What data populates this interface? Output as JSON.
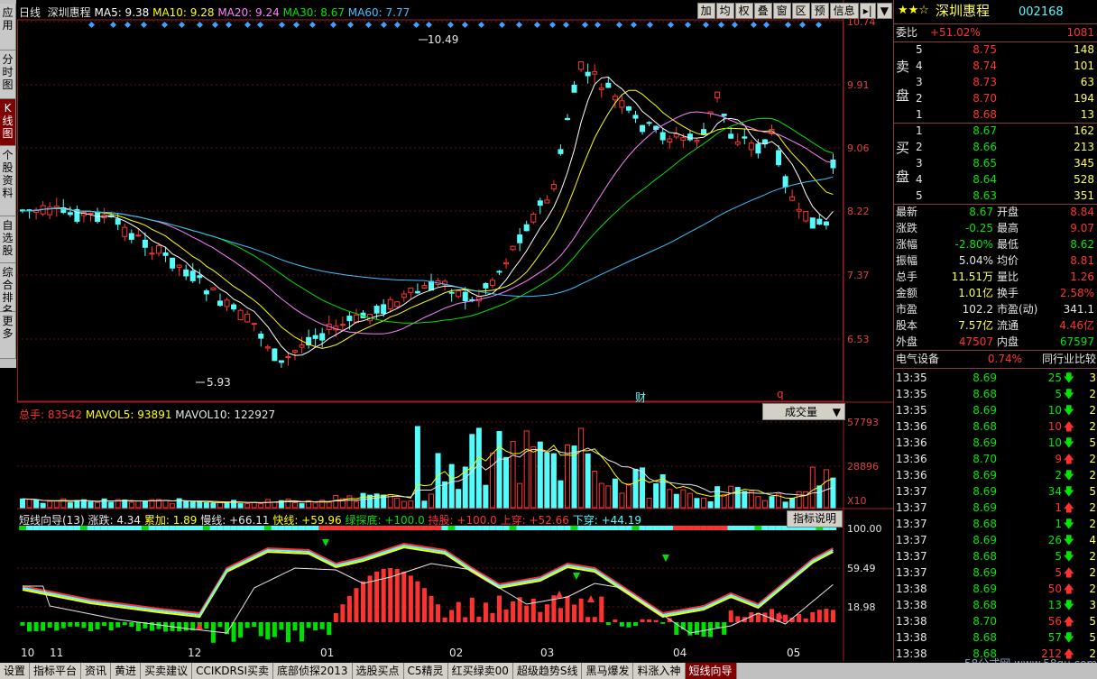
{
  "left_tabs": [
    {
      "label": "应用"
    },
    {
      "label": "分时图"
    },
    {
      "label": "K线图",
      "active": true
    },
    {
      "label": "个股资料"
    },
    {
      "label": "自选股"
    },
    {
      "label": "综合排名"
    },
    {
      "label": "更多"
    }
  ],
  "toolbar": [
    "加",
    "均",
    "权",
    "叠",
    "窗",
    "区",
    "预",
    "信息"
  ],
  "main_legend": {
    "period": "日线",
    "name": "深圳惠程",
    "ma": [
      {
        "label": "MA5: 9.38",
        "color": "#ffffff"
      },
      {
        "label": "MA10: 9.28",
        "color": "#ffff00"
      },
      {
        "label": "MA20: 9.24",
        "color": "#ff80ff"
      },
      {
        "label": "MA30: 8.67",
        "color": "#00e000"
      },
      {
        "label": "MA60: 7.77",
        "color": "#40c0ff"
      }
    ]
  },
  "price_axis": [
    "10.74",
    "9.91",
    "9.06",
    "8.22",
    "7.37",
    "6.53"
  ],
  "annotations": {
    "high": "10.49",
    "low": "5.93",
    "cai": "财",
    "q": "q"
  },
  "vol_legend": {
    "total": "总手: 83542",
    "mavol5": "MAVOL5: 93891",
    "mavol10": "MAVOL10: 122927",
    "selector": "成交量"
  },
  "vol_axis": [
    "57793",
    "28896",
    "X10"
  ],
  "ind_legend": {
    "title": "短线向导(13)",
    "items": [
      {
        "label": "涨跌: 4.34",
        "color": "#e6e6e6"
      },
      {
        "label": "累加: 1.89",
        "color": "#ffff00"
      },
      {
        "label": "慢线: +66.11",
        "color": "#e6e6e6"
      },
      {
        "label": "快线: +59.96",
        "color": "#ffff00"
      },
      {
        "label": "绿探底: +100.0",
        "color": "#00e000"
      },
      {
        "label": "持股: +100.0",
        "color": "#ff3232"
      },
      {
        "label": "上穿: +52.66",
        "color": "#ff3232"
      },
      {
        "label": "下穿: +44.19",
        "color": "#54fcfc"
      }
    ],
    "button": "指标说明"
  },
  "ind_axis": [
    "100.00",
    "59.49",
    "18.98"
  ],
  "date_axis": [
    "10",
    "11",
    "12",
    "01",
    "02",
    "03",
    "04",
    "05"
  ],
  "panel": {
    "stock_name": "深圳惠程",
    "stock_code": "002168",
    "weibi_label": "委比",
    "weibi": "+51.02%",
    "weicha": "1081",
    "sell_label": [
      "卖",
      "盘"
    ],
    "buy_label": [
      "买",
      "盘"
    ],
    "sell": [
      [
        "5",
        "8.75",
        "148"
      ],
      [
        "4",
        "8.74",
        "101"
      ],
      [
        "3",
        "8.73",
        "63"
      ],
      [
        "2",
        "8.70",
        "194"
      ],
      [
        "1",
        "8.68",
        "13"
      ]
    ],
    "buy": [
      [
        "1",
        "8.67",
        "162"
      ],
      [
        "2",
        "8.66",
        "213"
      ],
      [
        "3",
        "8.65",
        "345"
      ],
      [
        "4",
        "8.64",
        "528"
      ],
      [
        "5",
        "8.63",
        "351"
      ]
    ],
    "stats": [
      [
        "最新",
        "8.67",
        "开盘",
        "8.84"
      ],
      [
        "涨跌",
        "-0.25",
        "最高",
        "9.07"
      ],
      [
        "涨幅",
        "-2.80%",
        "最低",
        "8.62"
      ],
      [
        "振幅",
        "5.04%",
        "均价",
        "8.81"
      ],
      [
        "总手",
        "11.51万",
        "量比",
        "1.26"
      ],
      [
        "金额",
        "1.01亿",
        "换手",
        "2.58%"
      ],
      [
        "市盈",
        "102.2",
        "市盈(动)",
        "341.1"
      ],
      [
        "股本",
        "7.57亿",
        "流通",
        "4.46亿"
      ],
      [
        "外盘",
        "47507",
        "内盘",
        "67597"
      ]
    ],
    "industry": "电气设备",
    "industry_pct": "0.74%",
    "compare_button": "同行业比较",
    "ticks": [
      [
        "13:35",
        "8.69",
        "25",
        "down",
        "3"
      ],
      [
        "13:35",
        "8.68",
        "5",
        "down",
        "2"
      ],
      [
        "13:35",
        "8.69",
        "10",
        "down",
        "2"
      ],
      [
        "13:36",
        "8.68",
        "10",
        "up",
        "2"
      ],
      [
        "13:36",
        "8.69",
        "10",
        "down",
        "5"
      ],
      [
        "13:36",
        "8.70",
        "9",
        "up",
        "2"
      ],
      [
        "13:36",
        "8.69",
        "2",
        "down",
        "2"
      ],
      [
        "13:37",
        "8.69",
        "34",
        "down",
        "5"
      ],
      [
        "13:37",
        "8.69",
        "1",
        "up",
        "2"
      ],
      [
        "13:37",
        "8.68",
        "1",
        "down",
        "2"
      ],
      [
        "13:37",
        "8.69",
        "26",
        "down",
        "4"
      ],
      [
        "13:37",
        "8.68",
        "5",
        "down",
        "2"
      ],
      [
        "13:37",
        "8.69",
        "5",
        "up",
        "2"
      ],
      [
        "13:38",
        "8.69",
        "50",
        "up",
        "2"
      ],
      [
        "13:38",
        "8.68",
        "13",
        "down",
        "3"
      ],
      [
        "13:38",
        "8.70",
        "56",
        "up",
        "5"
      ],
      [
        "13:38",
        "8.68",
        "57",
        "down",
        "5"
      ],
      [
        "13:38",
        "8.68",
        "212",
        "up",
        "2"
      ],
      [
        "13:38",
        "",
        "",
        "",
        ""
      ]
    ],
    "bottom_tabs": [
      "细",
      "诊"
    ]
  },
  "bottom_tabs": [
    "设置",
    "指标平台",
    "资讯",
    "黄进",
    "买卖建议",
    "CCIKDRSI买卖",
    "底部侦探2013",
    "选股买点",
    "C5精灵",
    "红买绿卖00",
    "超级趋势S线",
    "黑马爆发",
    "料涨入神",
    "短线向导"
  ],
  "watermark": "58公式网 www.58gu.com"
}
